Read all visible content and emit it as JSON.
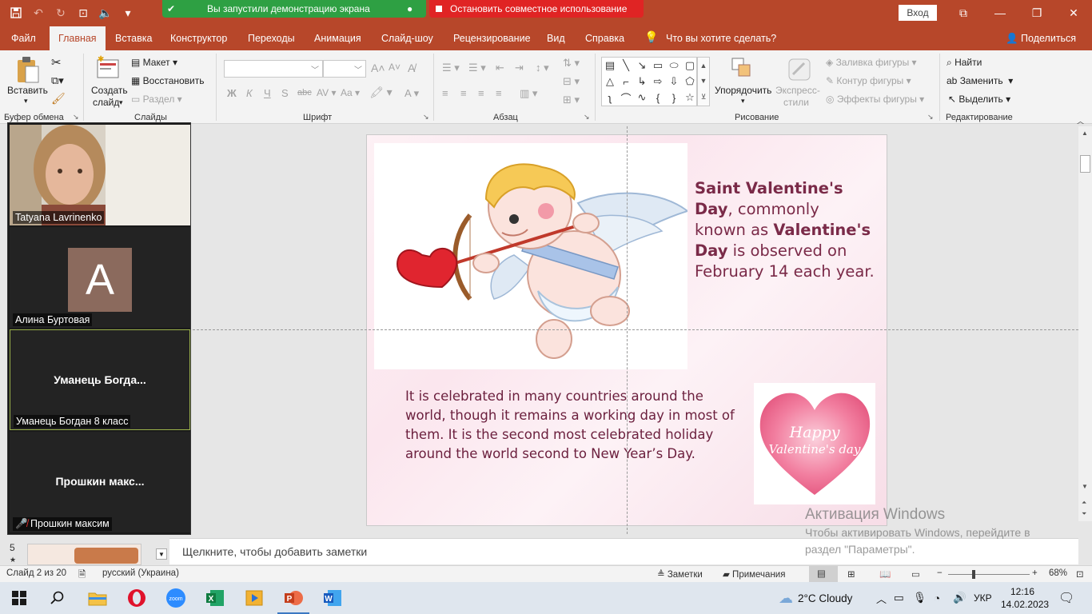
{
  "titlebar": {
    "sharing_banner": "Вы запустили демонстрацию экрана",
    "stop_sharing": "Остановить совместное использование",
    "signin": "Вход"
  },
  "tabs": [
    "Файл",
    "Главная",
    "Вставка",
    "Конструктор",
    "Переходы",
    "Анимация",
    "Слайд-шоу",
    "Рецензирование",
    "Вид",
    "Справка"
  ],
  "tell_me": "Что вы хотите сделать?",
  "share": "Поделиться",
  "ribbon": {
    "paste": "Вставить",
    "clipboard": "Буфер обмена",
    "new_slide_1": "Создать",
    "new_slide_2": "слайд",
    "layout": "Макет",
    "reset": "Восстановить",
    "section": "Раздел",
    "slides": "Слайды",
    "font_group": "Шрифт",
    "paragraph": "Абзац",
    "arrange": "Упорядочить",
    "quick_styles_1": "Экспресс-",
    "quick_styles_2": "стили",
    "shape_fill": "Заливка фигуры",
    "shape_outline": "Контур фигуры",
    "shape_effects": "Эффекты фигуры",
    "drawing": "Рисование",
    "find": "Найти",
    "replace": "Заменить",
    "select": "Выделить",
    "editing": "Редактирование"
  },
  "slide": {
    "t1_bold1": "Saint Valentine's Day",
    "t1_plain1": ", commonly known as ",
    "t1_bold2": "Valentine's Day",
    "t1_plain2": " is observed on February 14 each year.",
    "t2": "It is celebrated in many countries around the world, though it remains a working day in most of them. It is the second most celebrated holiday around the world second to New Year’s Day.",
    "heart_text_1": "Happy",
    "heart_text_2": "Valentine's day"
  },
  "zoom": {
    "p1": "Tatyana Lavrinenko",
    "p2": "Алина Буртовая",
    "p2_initial": "A",
    "p3_center": "Уманець  Богда...",
    "p3": "Уманець Богдан 8 класс",
    "p4_center": "Прошкин  макс...",
    "p4": "Прошкин максим"
  },
  "thumb": {
    "number": "5",
    "star": "★"
  },
  "notes_placeholder": "Щелкните, чтобы добавить заметки",
  "watermark": {
    "title": "Активация Windows",
    "body": "Чтобы активировать Windows, перейдите в раздел \"Параметры\"."
  },
  "status": {
    "slide": "Слайд 2 из 20",
    "lang": "русский (Украина)",
    "notes": "Заметки",
    "comments": "Примечания",
    "zoom": "68%"
  },
  "taskbar": {
    "weather": "2°C  Cloudy",
    "lang": "УКР",
    "time": "12:16",
    "date": "14.02.2023"
  }
}
